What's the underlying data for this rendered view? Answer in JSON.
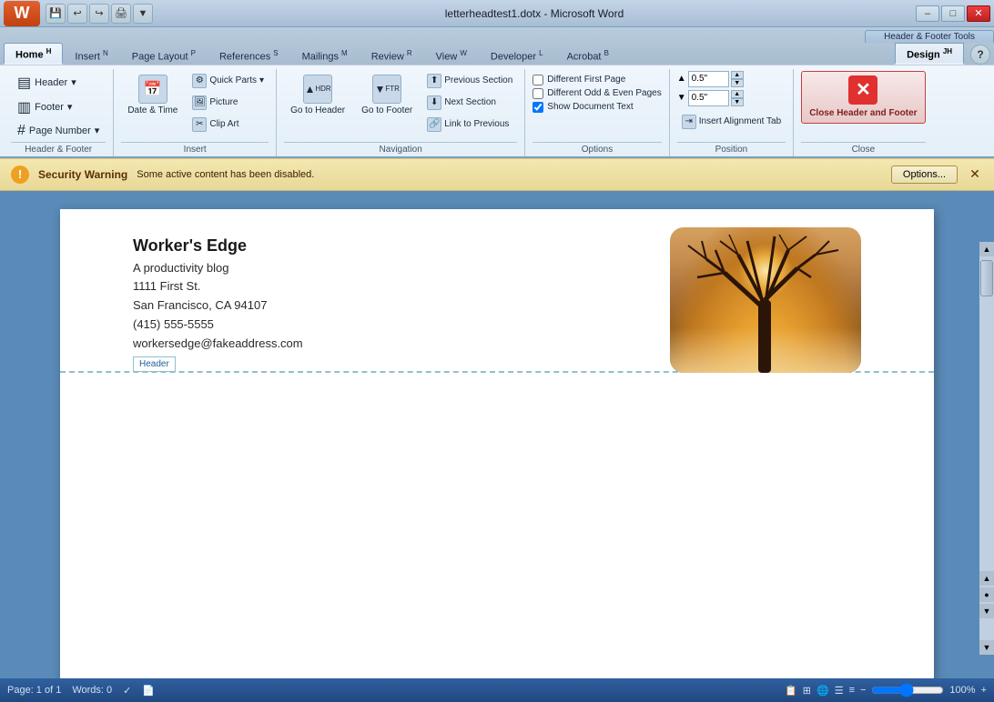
{
  "titleBar": {
    "title": "letterheadtest1.dotx - Microsoft Word",
    "minimizeLabel": "–",
    "maximizeLabel": "□",
    "closeLabel": "✕"
  },
  "quickAccess": [
    "↩",
    "↪",
    "💾",
    "🖨",
    "🔍"
  ],
  "ribbonTabs": [
    {
      "label": "Home",
      "key": "H",
      "active": false
    },
    {
      "label": "Insert",
      "key": "N",
      "active": false
    },
    {
      "label": "Page Layout",
      "key": "P",
      "active": false
    },
    {
      "label": "References",
      "key": "S",
      "active": false
    },
    {
      "label": "Mailings",
      "key": "M",
      "active": false
    },
    {
      "label": "Review",
      "key": "R",
      "active": false
    },
    {
      "label": "View",
      "key": "W",
      "active": false
    },
    {
      "label": "Developer",
      "key": "L",
      "active": false
    },
    {
      "label": "Acrobat",
      "key": "B",
      "active": false
    },
    {
      "label": "Design",
      "key": "JH",
      "active": true
    }
  ],
  "headerFooterToolsLabel": "Header & Footer Tools",
  "groups": {
    "headerFooter": {
      "label": "Header & Footer",
      "headerBtn": "Header",
      "footerBtn": "Footer",
      "pageNumberBtn": "Page Number"
    },
    "insert": {
      "label": "Insert",
      "dateTimeBtn": "Date & Time",
      "quickPartsBtn": "Quick Parts",
      "pictureBtn": "Picture",
      "clipArtBtn": "Clip Art"
    },
    "navigation": {
      "label": "Navigation",
      "gotoHeaderBtn": "Go to Header",
      "gotoFooterBtn": "Go to Footer",
      "prevSectionBtn": "Previous Section",
      "nextSectionBtn": "Next Section",
      "linkToPreviousBtn": "Link to Previous"
    },
    "options": {
      "label": "Options",
      "differentFirstPage": "Different First Page",
      "differentOddEven": "Different Odd & Even Pages",
      "showDocumentText": "Show Document Text",
      "showDocumentTextChecked": true
    },
    "position": {
      "label": "Position",
      "topValue": "0.5\"",
      "bottomValue": "0.5\"",
      "insertAlignmentBtn": "Insert Alignment Tab"
    },
    "close": {
      "label": "Close",
      "closeHeaderFooterBtn": "Close Header and Footer"
    }
  },
  "securityBar": {
    "title": "Security Warning",
    "message": "Some active content has been disabled.",
    "optionsBtn": "Options...",
    "show": true
  },
  "document": {
    "company": "Worker's Edge",
    "tagline": "A productivity blog",
    "address1": "1111 First St.",
    "address2": "San Francisco, CA 94107",
    "phone": "(415) 555-5555",
    "email": "workersedge@fakeaddress.com",
    "headerLabel": "Header"
  },
  "statusBar": {
    "pageInfo": "Page: 1 of 1",
    "wordCount": "Words: 0",
    "zoom": "100%"
  }
}
